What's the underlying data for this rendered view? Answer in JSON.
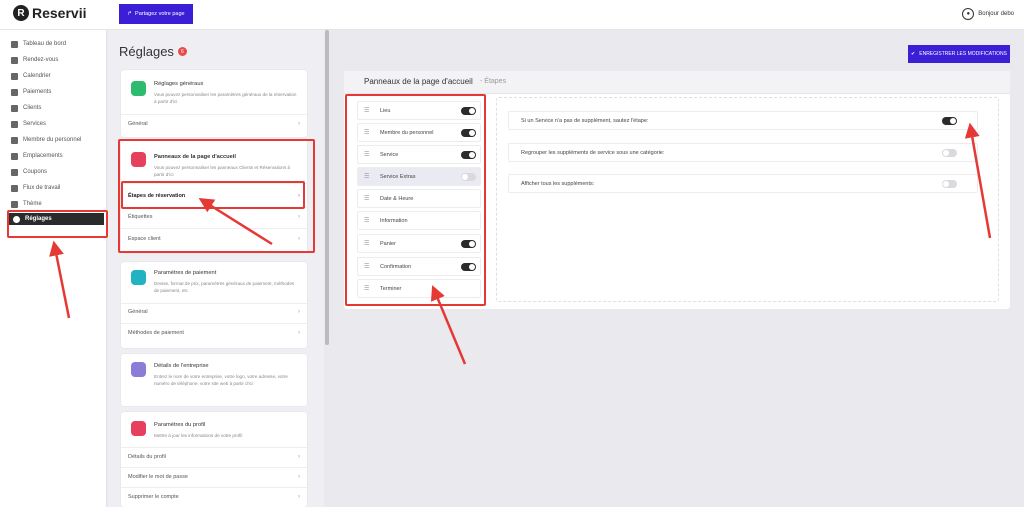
{
  "brand": {
    "name": "Reservii"
  },
  "topbar": {
    "share_label": "Partagez votre page",
    "greeting": "Bonjour debo"
  },
  "sidebar": {
    "items": [
      {
        "label": "Tableau de bord",
        "icon": "grid-icon"
      },
      {
        "label": "Rendez-vous",
        "icon": "clock-icon"
      },
      {
        "label": "Calendrier",
        "icon": "calendar-icon"
      },
      {
        "label": "Paiements",
        "icon": "money-icon"
      },
      {
        "label": "Clients",
        "icon": "users-icon"
      },
      {
        "label": "Services",
        "icon": "list-icon"
      },
      {
        "label": "Membre du personnel",
        "icon": "person-icon"
      },
      {
        "label": "Emplacements",
        "icon": "location-icon"
      },
      {
        "label": "Coupons",
        "icon": "coupon-icon"
      },
      {
        "label": "Flux de travail",
        "icon": "workflow-icon"
      },
      {
        "label": "Thème",
        "icon": "brush-icon"
      },
      {
        "label": "Réglages",
        "icon": "gear-icon",
        "active": true
      }
    ]
  },
  "settings": {
    "title": "Réglages",
    "badge": "6",
    "cards": [
      {
        "title": "Réglages généraux",
        "desc": "Vous pouvez personnaliser les paramètres généraux de la réservation à partir d'ici",
        "icon_color": "#2dbb6e",
        "rows": [
          "Général"
        ]
      },
      {
        "title": "Panneaux de la page d'accueil",
        "desc": "Vous pouvez personnaliser les panneaux Clients et Réservations à partir d'ici",
        "icon_color": "#e6405e",
        "rows": [
          "Étapes de réservation",
          "Étiquettes",
          "Espace client"
        ]
      },
      {
        "title": "Paramètres de paiement",
        "desc": "Devise, format de prix, paramètres généraux de paiement, méthodes de paiement, etc",
        "icon_color": "#23b1c4",
        "rows": [
          "Général",
          "Méthodes de paiement"
        ]
      },
      {
        "title": "Détails de l'entreprise",
        "desc": "Entrez le nom de votre entreprise, votre logo, votre adresse, votre numéro de téléphone, votre site web à partir d'ici",
        "icon_color": "#8b7cd8",
        "rows": []
      },
      {
        "title": "Paramètres du profil",
        "desc": "Mettre à jour les informations de votre profil",
        "icon_color": "#e6405e",
        "rows": [
          "Détails du profil",
          "Modifier le mot de passe",
          "Supprimer le compte"
        ]
      }
    ]
  },
  "panel": {
    "title": "Panneaux de la page d'accueil",
    "subtitle": "- Étapes",
    "save_label": "ENREGISTRER LES MODIFICATIONS",
    "steps": [
      {
        "label": "Lieu",
        "toggle": "on"
      },
      {
        "label": "Membre du personnel",
        "toggle": "on"
      },
      {
        "label": "Service",
        "toggle": "on"
      },
      {
        "label": "Service Extras",
        "toggle": "off",
        "selected": true
      },
      {
        "label": "Date & Heure",
        "toggle": "none"
      },
      {
        "label": "Information",
        "toggle": "none"
      },
      {
        "label": "Panier",
        "toggle": "on"
      },
      {
        "label": "Confirmation",
        "toggle": "on"
      },
      {
        "label": "Terminer",
        "toggle": "none"
      }
    ],
    "options": [
      {
        "label": "Si un Service n'a pas de supplément, sautez l'étape:",
        "toggle": "on"
      },
      {
        "label": "Regrouper les suppléments de service sous une catégorie:",
        "toggle": "off"
      },
      {
        "label": "Afficher tous les suppléments:",
        "toggle": "off"
      }
    ]
  },
  "colors": {
    "accent": "#3a1fd6",
    "highlight": "#e53935"
  }
}
